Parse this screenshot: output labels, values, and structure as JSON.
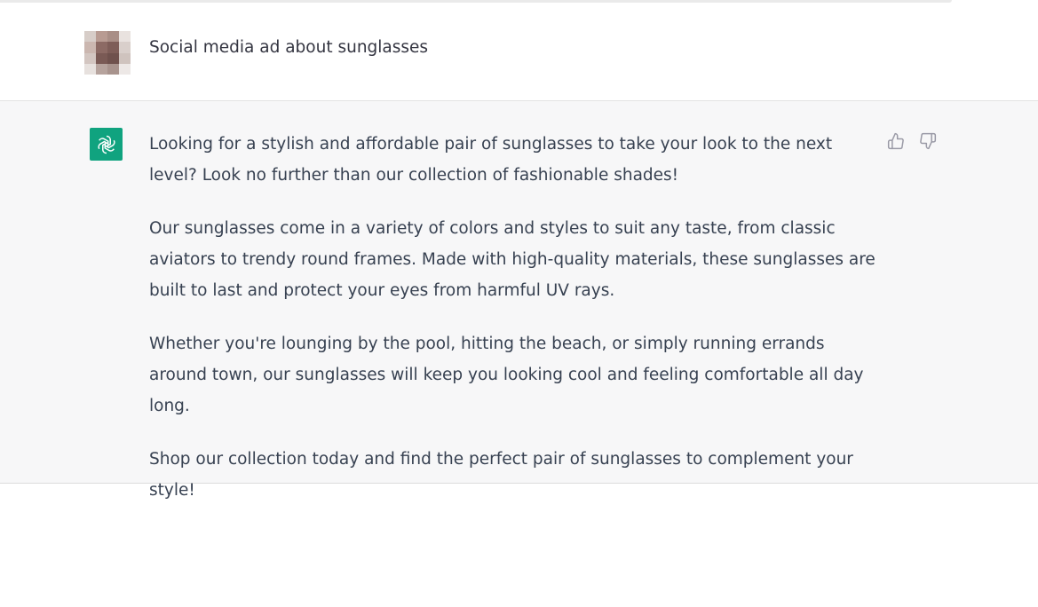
{
  "user_message": {
    "text": "Social media ad about sunglasses",
    "avatar_icon": "user-avatar-pixelated"
  },
  "assistant_message": {
    "avatar_icon": "openai-logo-icon",
    "avatar_color": "#10a37f",
    "paragraphs": [
      "Looking for a stylish and affordable pair of sunglasses to take your look to the next level? Look no further than our collection of fashionable shades!",
      "Our sunglasses come in a variety of colors and styles to suit any taste, from classic aviators to trendy round frames. Made with high-quality materials, these sunglasses are built to last and protect your eyes from harmful UV rays.",
      "Whether you're lounging by the pool, hitting the beach, or simply running errands around town, our sunglasses will keep you looking cool and feeling comfortable all day long.",
      "Shop our collection today and find the perfect pair of sunglasses to complement your style!"
    ]
  },
  "feedback": {
    "thumbs_up_icon": "thumbs-up-icon",
    "thumbs_down_icon": "thumbs-down-icon"
  },
  "colors": {
    "assistant_background": "#f7f7f8",
    "text": "#374151"
  }
}
